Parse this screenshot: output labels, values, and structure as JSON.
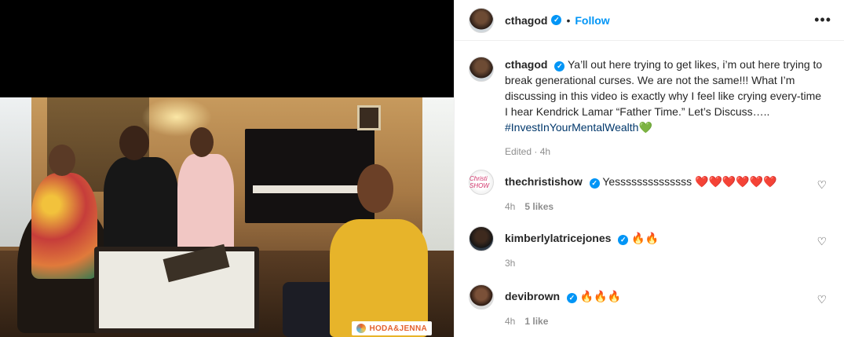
{
  "video": {
    "logo_text": "HODA&JENNA"
  },
  "header": {
    "username": "cthagod",
    "verified_mark": "✓",
    "separator": "•",
    "follow_label": "Follow",
    "more_label": "•••"
  },
  "caption": {
    "username": "cthagod",
    "text": "Ya’ll out here trying to get likes, i’m out here trying to break generational curses. We are not the same!!! What I’m discussing in this video is exactly why I feel like crying every-time I hear Kendrick Lamar “Father Time.” Let’s Discuss…..",
    "hashtag": "#InvestInYourMentalWealth",
    "emoji": "💚",
    "meta": "Edited · 4h"
  },
  "comments": [
    {
      "username": "thechristishow",
      "avatar_text": "Christi SHOW",
      "text": "Yessssssssssssss",
      "emoji": "❤️❤️❤️❤️❤️❤️",
      "time": "4h",
      "likes": "5 likes"
    },
    {
      "username": "kimberlylatricejones",
      "text": "",
      "emoji": "🔥🔥",
      "time": "3h",
      "likes": ""
    },
    {
      "username": "devibrown",
      "text": "",
      "emoji": "🔥🔥🔥",
      "time": "4h",
      "likes": "1 like"
    }
  ],
  "icons": {
    "heart": "♡"
  },
  "colors": {
    "accent": "#0095f6",
    "hashtag": "#00376b",
    "muted": "#8e8e8e"
  }
}
